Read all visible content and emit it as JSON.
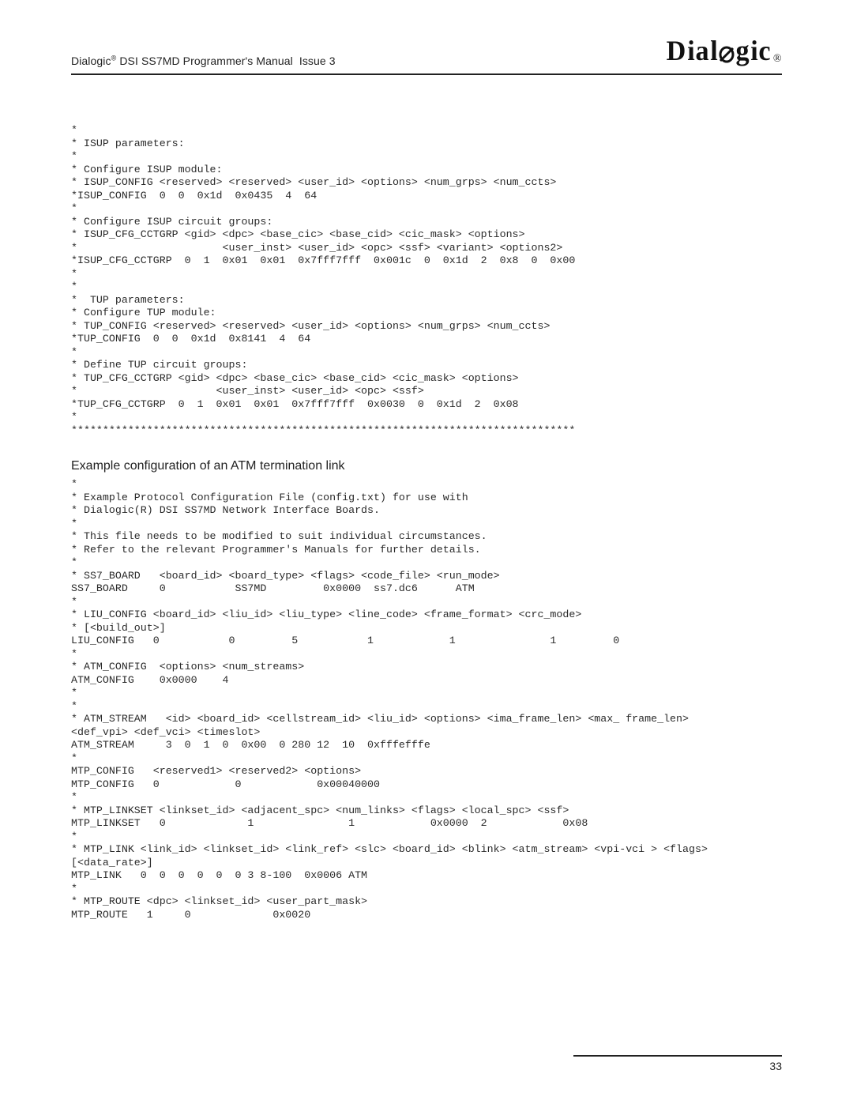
{
  "header": {
    "doc_title": "Dialogic® DSI SS7MD Programmer's Manual Issue 3",
    "brand": "Dialogic",
    "brand_mark": "®"
  },
  "code_block_1": "*\n* ISUP parameters:\n*\n* Configure ISUP module:\n* ISUP_CONFIG <reserved> <reserved> <user_id> <options> <num_grps> <num_ccts>\n*ISUP_CONFIG  0  0  0x1d  0x0435  4  64\n*\n* Configure ISUP circuit groups:\n* ISUP_CFG_CCTGRP <gid> <dpc> <base_cic> <base_cid> <cic_mask> <options>\n*                       <user_inst> <user_id> <opc> <ssf> <variant> <options2>\n*ISUP_CFG_CCTGRP  0  1  0x01  0x01  0x7fff7fff  0x001c  0  0x1d  2  0x8  0  0x00\n*\n*\n*  TUP parameters:\n* Configure TUP module:\n* TUP_CONFIG <reserved> <reserved> <user_id> <options> <num_grps> <num_ccts>\n*TUP_CONFIG  0  0  0x1d  0x8141  4  64\n*\n* Define TUP circuit groups:\n* TUP_CFG_CCTGRP <gid> <dpc> <base_cic> <base_cid> <cic_mask> <options>\n*                      <user_inst> <user_id> <opc> <ssf>\n*TUP_CFG_CCTGRP  0  1  0x01  0x01  0x7fff7fff  0x0030  0  0x1d  2  0x08\n*\n********************************************************************************",
  "section_title": "Example configuration of an ATM termination link",
  "code_block_2": "*\n* Example Protocol Configuration File (config.txt) for use with\n* Dialogic(R) DSI SS7MD Network Interface Boards.\n*\n* This file needs to be modified to suit individual circumstances.\n* Refer to the relevant Programmer's Manuals for further details.\n*\n* SS7_BOARD   <board_id> <board_type> <flags> <code_file> <run_mode>\nSS7_BOARD     0           SS7MD         0x0000  ss7.dc6      ATM\n*\n* LIU_CONFIG <board_id> <liu_id> <liu_type> <line_code> <frame_format> <crc_mode>\n* [<build_out>]\nLIU_CONFIG   0           0         5           1            1               1         0\n*\n* ATM_CONFIG  <options> <num_streams>\nATM_CONFIG    0x0000    4\n*\n*\n* ATM_STREAM   <id> <board_id> <cellstream_id> <liu_id> <options> <ima_frame_len> <max_ frame_len>\n<def_vpi> <def_vci> <timeslot>\nATM_STREAM     3  0  1  0  0x00  0 280 12  10  0xfffefffe\n*\nMTP_CONFIG   <reserved1> <reserved2> <options>\nMTP_CONFIG   0            0            0x00040000\n*\n* MTP_LINKSET <linkset_id> <adjacent_spc> <num_links> <flags> <local_spc> <ssf>\nMTP_LINKSET   0             1               1            0x0000  2            0x08\n*\n* MTP_LINK <link_id> <linkset_id> <link_ref> <slc> <board_id> <blink> <atm_stream> <vpi-vci > <flags>\n[<data_rate>]\nMTP_LINK   0  0  0  0  0  0 3 8-100  0x0006 ATM\n*\n* MTP_ROUTE <dpc> <linkset_id> <user_part_mask>\nMTP_ROUTE   1     0             0x0020",
  "footer": {
    "page_number": "33"
  }
}
